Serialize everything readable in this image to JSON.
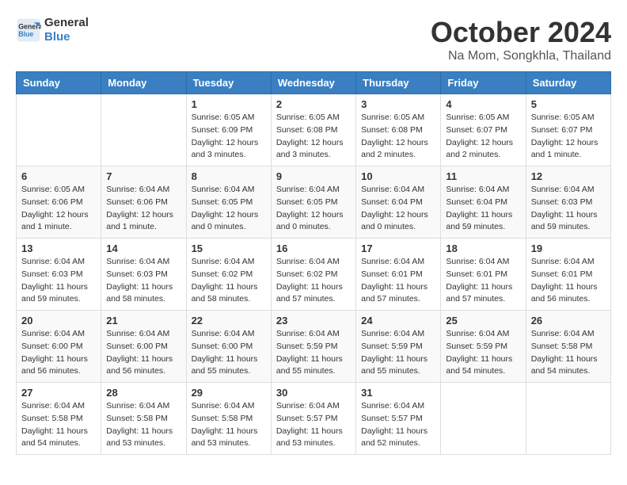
{
  "logo": {
    "line1": "General",
    "line2": "Blue"
  },
  "title": "October 2024",
  "location": "Na Mom, Songkhla, Thailand",
  "weekdays": [
    "Sunday",
    "Monday",
    "Tuesday",
    "Wednesday",
    "Thursday",
    "Friday",
    "Saturday"
  ],
  "weeks": [
    [
      {
        "day": "",
        "info": ""
      },
      {
        "day": "",
        "info": ""
      },
      {
        "day": "1",
        "info": "Sunrise: 6:05 AM\nSunset: 6:09 PM\nDaylight: 12 hours and 3 minutes."
      },
      {
        "day": "2",
        "info": "Sunrise: 6:05 AM\nSunset: 6:08 PM\nDaylight: 12 hours and 3 minutes."
      },
      {
        "day": "3",
        "info": "Sunrise: 6:05 AM\nSunset: 6:08 PM\nDaylight: 12 hours and 2 minutes."
      },
      {
        "day": "4",
        "info": "Sunrise: 6:05 AM\nSunset: 6:07 PM\nDaylight: 12 hours and 2 minutes."
      },
      {
        "day": "5",
        "info": "Sunrise: 6:05 AM\nSunset: 6:07 PM\nDaylight: 12 hours and 1 minute."
      }
    ],
    [
      {
        "day": "6",
        "info": "Sunrise: 6:05 AM\nSunset: 6:06 PM\nDaylight: 12 hours and 1 minute."
      },
      {
        "day": "7",
        "info": "Sunrise: 6:04 AM\nSunset: 6:06 PM\nDaylight: 12 hours and 1 minute."
      },
      {
        "day": "8",
        "info": "Sunrise: 6:04 AM\nSunset: 6:05 PM\nDaylight: 12 hours and 0 minutes."
      },
      {
        "day": "9",
        "info": "Sunrise: 6:04 AM\nSunset: 6:05 PM\nDaylight: 12 hours and 0 minutes."
      },
      {
        "day": "10",
        "info": "Sunrise: 6:04 AM\nSunset: 6:04 PM\nDaylight: 12 hours and 0 minutes."
      },
      {
        "day": "11",
        "info": "Sunrise: 6:04 AM\nSunset: 6:04 PM\nDaylight: 11 hours and 59 minutes."
      },
      {
        "day": "12",
        "info": "Sunrise: 6:04 AM\nSunset: 6:03 PM\nDaylight: 11 hours and 59 minutes."
      }
    ],
    [
      {
        "day": "13",
        "info": "Sunrise: 6:04 AM\nSunset: 6:03 PM\nDaylight: 11 hours and 59 minutes."
      },
      {
        "day": "14",
        "info": "Sunrise: 6:04 AM\nSunset: 6:03 PM\nDaylight: 11 hours and 58 minutes."
      },
      {
        "day": "15",
        "info": "Sunrise: 6:04 AM\nSunset: 6:02 PM\nDaylight: 11 hours and 58 minutes."
      },
      {
        "day": "16",
        "info": "Sunrise: 6:04 AM\nSunset: 6:02 PM\nDaylight: 11 hours and 57 minutes."
      },
      {
        "day": "17",
        "info": "Sunrise: 6:04 AM\nSunset: 6:01 PM\nDaylight: 11 hours and 57 minutes."
      },
      {
        "day": "18",
        "info": "Sunrise: 6:04 AM\nSunset: 6:01 PM\nDaylight: 11 hours and 57 minutes."
      },
      {
        "day": "19",
        "info": "Sunrise: 6:04 AM\nSunset: 6:01 PM\nDaylight: 11 hours and 56 minutes."
      }
    ],
    [
      {
        "day": "20",
        "info": "Sunrise: 6:04 AM\nSunset: 6:00 PM\nDaylight: 11 hours and 56 minutes."
      },
      {
        "day": "21",
        "info": "Sunrise: 6:04 AM\nSunset: 6:00 PM\nDaylight: 11 hours and 56 minutes."
      },
      {
        "day": "22",
        "info": "Sunrise: 6:04 AM\nSunset: 6:00 PM\nDaylight: 11 hours and 55 minutes."
      },
      {
        "day": "23",
        "info": "Sunrise: 6:04 AM\nSunset: 5:59 PM\nDaylight: 11 hours and 55 minutes."
      },
      {
        "day": "24",
        "info": "Sunrise: 6:04 AM\nSunset: 5:59 PM\nDaylight: 11 hours and 55 minutes."
      },
      {
        "day": "25",
        "info": "Sunrise: 6:04 AM\nSunset: 5:59 PM\nDaylight: 11 hours and 54 minutes."
      },
      {
        "day": "26",
        "info": "Sunrise: 6:04 AM\nSunset: 5:58 PM\nDaylight: 11 hours and 54 minutes."
      }
    ],
    [
      {
        "day": "27",
        "info": "Sunrise: 6:04 AM\nSunset: 5:58 PM\nDaylight: 11 hours and 54 minutes."
      },
      {
        "day": "28",
        "info": "Sunrise: 6:04 AM\nSunset: 5:58 PM\nDaylight: 11 hours and 53 minutes."
      },
      {
        "day": "29",
        "info": "Sunrise: 6:04 AM\nSunset: 5:58 PM\nDaylight: 11 hours and 53 minutes."
      },
      {
        "day": "30",
        "info": "Sunrise: 6:04 AM\nSunset: 5:57 PM\nDaylight: 11 hours and 53 minutes."
      },
      {
        "day": "31",
        "info": "Sunrise: 6:04 AM\nSunset: 5:57 PM\nDaylight: 11 hours and 52 minutes."
      },
      {
        "day": "",
        "info": ""
      },
      {
        "day": "",
        "info": ""
      }
    ]
  ]
}
